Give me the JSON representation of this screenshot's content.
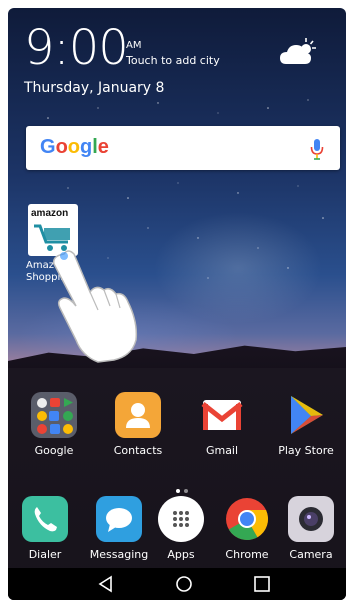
{
  "status": {
    "time": "9:00",
    "ampm": "AM",
    "weather_hint": "Touch to add city",
    "date": "Thursday, January 8",
    "weather_icon": "cloud-sun-icon"
  },
  "search": {
    "logo_text": "Google",
    "logo_colors": [
      "#4285F4",
      "#EA4335",
      "#FBBC05",
      "#4285F4",
      "#34A853",
      "#EA4335"
    ],
    "mic_icon": "mic-icon"
  },
  "desktop_app": {
    "icon_text": "amazon",
    "label": "Amazon Shopping"
  },
  "apps": [
    {
      "label": "Google",
      "icon": "folder-icon"
    },
    {
      "label": "Contacts",
      "icon": "contacts-icon"
    },
    {
      "label": "Gmail",
      "icon": "gmail-icon"
    },
    {
      "label": "Play Store",
      "icon": "play-store-icon"
    }
  ],
  "dock": [
    {
      "label": "Dialer",
      "icon": "phone-icon"
    },
    {
      "label": "Messaging",
      "icon": "message-icon"
    },
    {
      "label": "Apps",
      "icon": "apps-grid-icon"
    },
    {
      "label": "Chrome",
      "icon": "chrome-icon"
    },
    {
      "label": "Camera",
      "icon": "camera-icon"
    }
  ],
  "page_indicator": {
    "current": 1,
    "total": 2
  },
  "nav": {
    "back": "back-icon",
    "home": "home-icon",
    "recent": "recent-icon"
  }
}
